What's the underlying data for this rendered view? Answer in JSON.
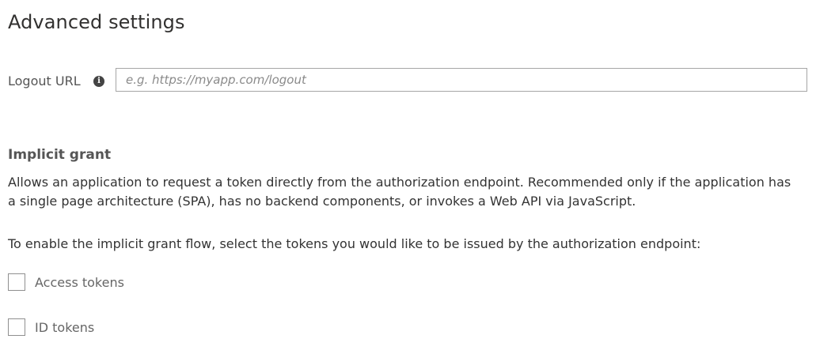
{
  "page": {
    "title": "Advanced settings"
  },
  "logout": {
    "label": "Logout URL",
    "info_icon": "info-icon",
    "placeholder": "e.g. https://myapp.com/logout",
    "value": ""
  },
  "implicit_grant": {
    "title": "Implicit grant",
    "description": "Allows an application to request a token directly from the authorization endpoint. Recommended only if the application has a single page architecture (SPA), has no backend components, or invokes a Web API via JavaScript.",
    "enable_text": "To enable the implicit grant flow, select the tokens you would like to be issued by the authorization endpoint:",
    "options": [
      {
        "label": "Access tokens",
        "checked": false
      },
      {
        "label": "ID tokens",
        "checked": false
      }
    ]
  }
}
